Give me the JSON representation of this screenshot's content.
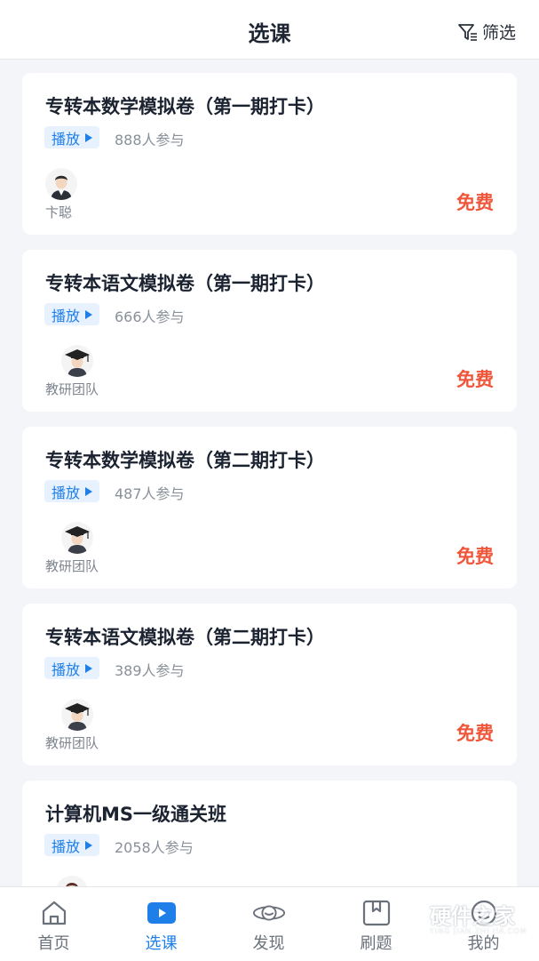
{
  "header": {
    "title": "选课",
    "filter_label": "筛选",
    "filter_icon": "filter-icon"
  },
  "courses": [
    {
      "title": "专转本数学模拟卷（第一期打卡）",
      "tag": "播放",
      "participants": "888人参与",
      "teacher": "卞聪",
      "price": "免费"
    },
    {
      "title": "专转本语文模拟卷（第一期打卡）",
      "tag": "播放",
      "participants": "666人参与",
      "teacher": "教研团队",
      "price": "免费"
    },
    {
      "title": "专转本数学模拟卷（第二期打卡）",
      "tag": "播放",
      "participants": "487人参与",
      "teacher": "教研团队",
      "price": "免费"
    },
    {
      "title": "专转本语文模拟卷（第二期打卡）",
      "tag": "播放",
      "participants": "389人参与",
      "teacher": "教研团队",
      "price": "免费"
    },
    {
      "title": "计算机MS一级通关班",
      "tag": "播放",
      "participants": "2058人参与",
      "teacher": "",
      "price": ""
    }
  ],
  "tabbar": {
    "items": [
      {
        "label": "首页",
        "icon": "home-icon"
      },
      {
        "label": "选课",
        "icon": "play-icon",
        "active": true
      },
      {
        "label": "发现",
        "icon": "planet-icon"
      },
      {
        "label": "刷题",
        "icon": "bookmark-icon"
      },
      {
        "label": "我的",
        "icon": "profile-icon"
      }
    ]
  },
  "watermark": {
    "text": "硬件之家",
    "sub": "YING JIAN ZHI JIA.COM"
  },
  "colors": {
    "accent": "#1f7fe8",
    "price": "#f0563a",
    "background": "#f3f5f8"
  }
}
